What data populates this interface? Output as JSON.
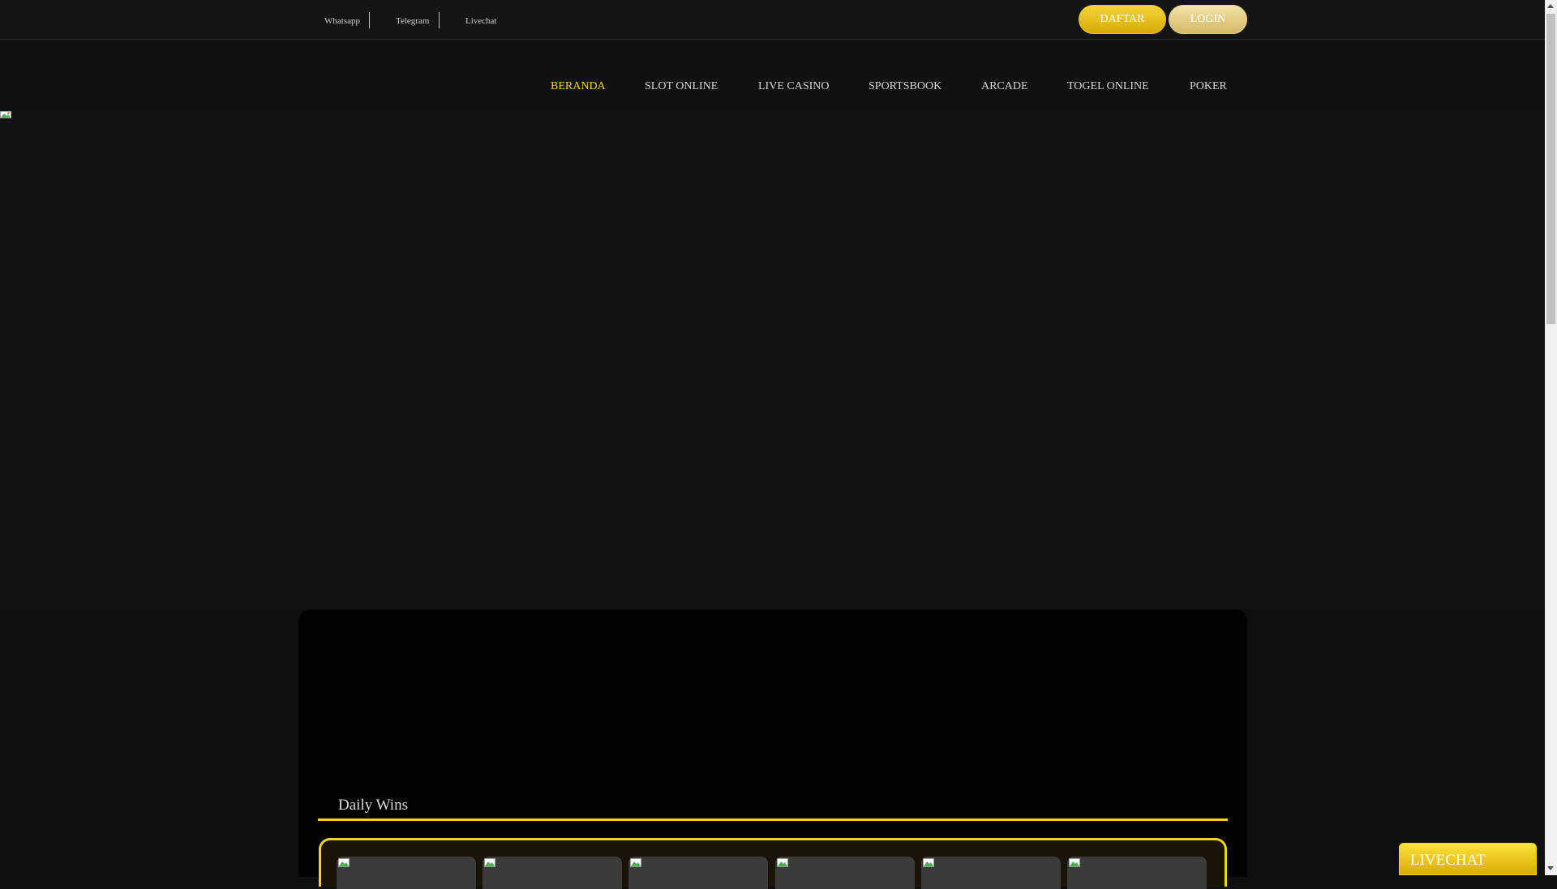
{
  "topbar": {
    "links": [
      {
        "label": "Whatsapp"
      },
      {
        "label": "Telegram"
      },
      {
        "label": "Livechat"
      }
    ],
    "register_label": "DAFTAR",
    "login_label": "LOGIN"
  },
  "nav": {
    "items": [
      {
        "label": "BERANDA",
        "active": true
      },
      {
        "label": "SLOT ONLINE"
      },
      {
        "label": "LIVE CASINO"
      },
      {
        "label": "SPORTSBOOK"
      },
      {
        "label": "ARCADE"
      },
      {
        "label": "TOGEL ONLINE"
      },
      {
        "label": "POKER"
      }
    ]
  },
  "main": {
    "daily_wins_title": "Daily Wins",
    "win_cards_count": 6
  },
  "floating": {
    "livechat_label": "LIVECHAT"
  },
  "colors": {
    "accent": "#f7d21b",
    "gold_dark": "#d7aa05"
  }
}
